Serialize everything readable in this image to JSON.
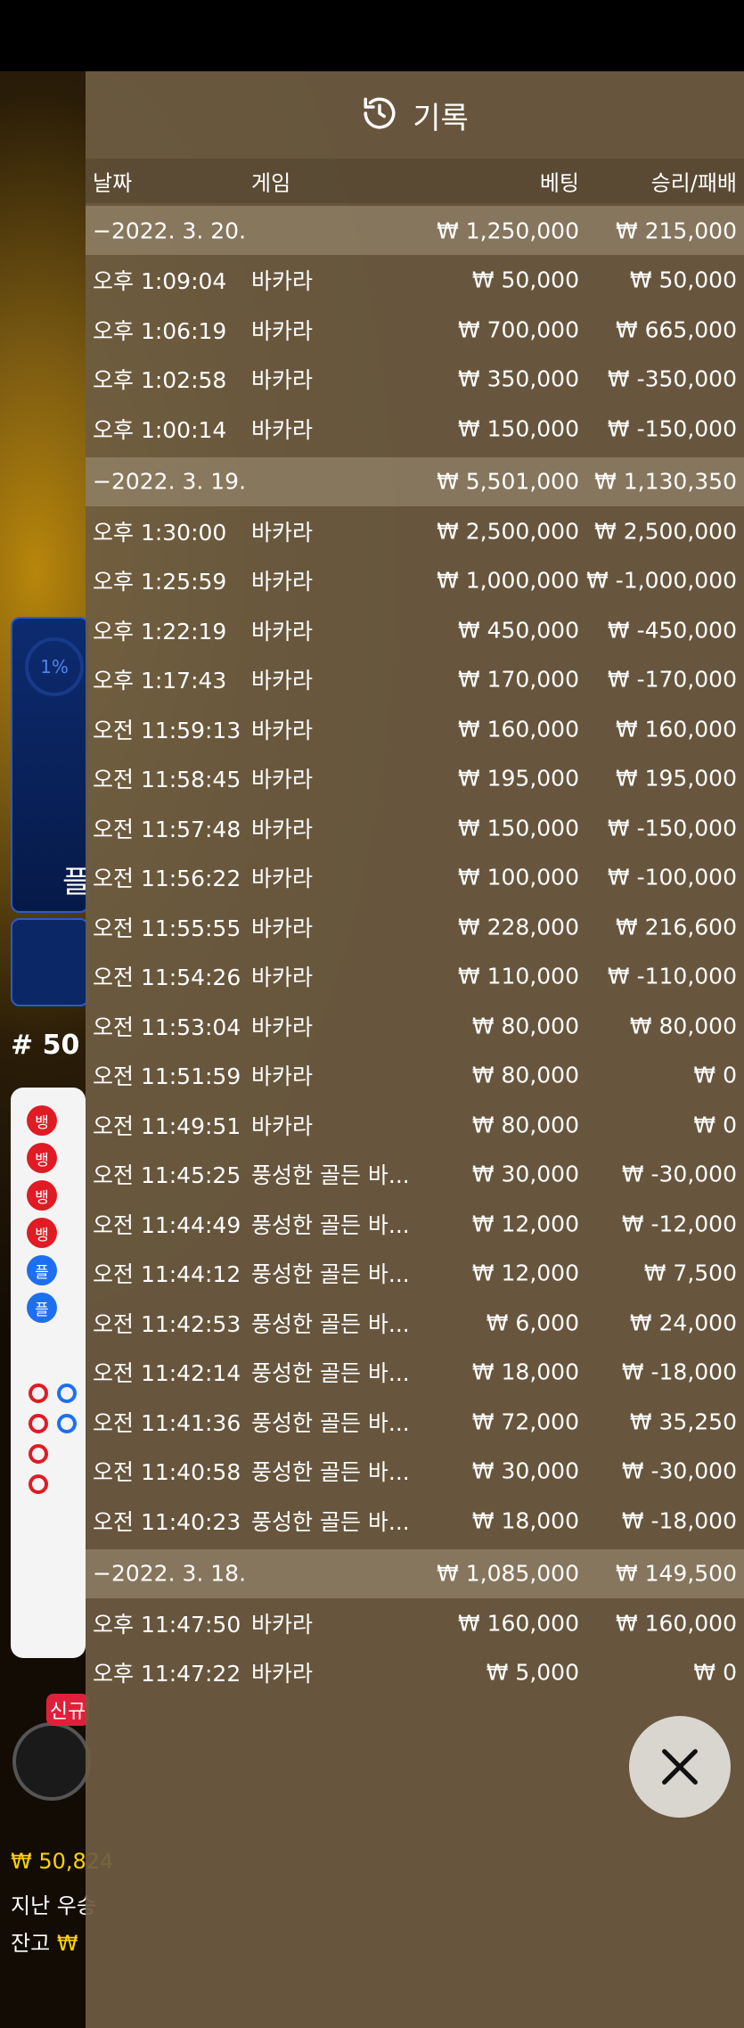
{
  "background": {
    "percent": "1%",
    "bet_char": "플",
    "game_number": "# 50",
    "new_badge": "신규",
    "balance_line": "₩ 50,824",
    "last_win_label": "지난 우승",
    "balance_label": "잔고",
    "balance_value": "₩"
  },
  "panel": {
    "title": "기록",
    "columns": {
      "date": "날짜",
      "game": "게임",
      "bet": "베팅",
      "result": "승리/패배"
    },
    "groups": [
      {
        "date": "−2022. 3. 20.",
        "bet": "₩ 1,250,000",
        "result": "₩ 215,000"
      },
      {
        "date": "−2022. 3. 19.",
        "bet": "₩ 5,501,000",
        "result": "₩ 1,130,350"
      },
      {
        "date": "−2022. 3. 18.",
        "bet": "₩ 1,085,000",
        "result": "₩ 149,500"
      }
    ],
    "rows": [
      {
        "time": "오후 1:09:04",
        "game": "바카라",
        "bet": "₩ 50,000",
        "result": "₩ 50,000"
      },
      {
        "time": "오후 1:06:19",
        "game": "바카라",
        "bet": "₩ 700,000",
        "result": "₩ 665,000"
      },
      {
        "time": "오후 1:02:58",
        "game": "바카라",
        "bet": "₩ 350,000",
        "result": "₩ -350,000"
      },
      {
        "time": "오후 1:00:14",
        "game": "바카라",
        "bet": "₩ 150,000",
        "result": "₩ -150,000"
      },
      {
        "time": "오후 1:30:00",
        "game": "바카라",
        "bet": "₩ 2,500,000",
        "result": "₩ 2,500,000"
      },
      {
        "time": "오후 1:25:59",
        "game": "바카라",
        "bet": "₩ 1,000,000",
        "result": "₩ -1,000,000"
      },
      {
        "time": "오후 1:22:19",
        "game": "바카라",
        "bet": "₩ 450,000",
        "result": "₩ -450,000"
      },
      {
        "time": "오후 1:17:43",
        "game": "바카라",
        "bet": "₩ 170,000",
        "result": "₩ -170,000"
      },
      {
        "time": "오전 11:59:13",
        "game": "바카라",
        "bet": "₩ 160,000",
        "result": "₩ 160,000"
      },
      {
        "time": "오전 11:58:45",
        "game": "바카라",
        "bet": "₩ 195,000",
        "result": "₩ 195,000"
      },
      {
        "time": "오전 11:57:48",
        "game": "바카라",
        "bet": "₩ 150,000",
        "result": "₩ -150,000"
      },
      {
        "time": "오전 11:56:22",
        "game": "바카라",
        "bet": "₩ 100,000",
        "result": "₩ -100,000"
      },
      {
        "time": "오전 11:55:55",
        "game": "바카라",
        "bet": "₩ 228,000",
        "result": "₩ 216,600"
      },
      {
        "time": "오전 11:54:26",
        "game": "바카라",
        "bet": "₩ 110,000",
        "result": "₩ -110,000"
      },
      {
        "time": "오전 11:53:04",
        "game": "바카라",
        "bet": "₩ 80,000",
        "result": "₩ 80,000"
      },
      {
        "time": "오전 11:51:59",
        "game": "바카라",
        "bet": "₩ 80,000",
        "result": "₩ 0"
      },
      {
        "time": "오전 11:49:51",
        "game": "바카라",
        "bet": "₩ 80,000",
        "result": "₩ 0"
      },
      {
        "time": "오전 11:45:25",
        "game": "풍성한 골든 바...",
        "bet": "₩ 30,000",
        "result": "₩ -30,000"
      },
      {
        "time": "오전 11:44:49",
        "game": "풍성한 골든 바...",
        "bet": "₩ 12,000",
        "result": "₩ -12,000"
      },
      {
        "time": "오전 11:44:12",
        "game": "풍성한 골든 바...",
        "bet": "₩ 12,000",
        "result": "₩ 7,500"
      },
      {
        "time": "오전 11:42:53",
        "game": "풍성한 골든 바...",
        "bet": "₩ 6,000",
        "result": "₩ 24,000"
      },
      {
        "time": "오전 11:42:14",
        "game": "풍성한 골든 바...",
        "bet": "₩ 18,000",
        "result": "₩ -18,000"
      },
      {
        "time": "오전 11:41:36",
        "game": "풍성한 골든 바...",
        "bet": "₩ 72,000",
        "result": "₩ 35,250"
      },
      {
        "time": "오전 11:40:58",
        "game": "풍성한 골든 바...",
        "bet": "₩ 30,000",
        "result": "₩ -30,000"
      },
      {
        "time": "오전 11:40:23",
        "game": "풍성한 골든 바...",
        "bet": "₩ 18,000",
        "result": "₩ -18,000"
      },
      {
        "time": "오후 11:47:50",
        "game": "바카라",
        "bet": "₩ 160,000",
        "result": "₩ 160,000"
      },
      {
        "time": "오후 11:47:22",
        "game": "바카라",
        "bet": "₩ 5,000",
        "result": "₩ 0"
      }
    ],
    "close_icon": "close-icon",
    "history_icon": "history-icon"
  },
  "colors": {
    "panel_bg": "#6e5c42",
    "banker_red": "#e01b24",
    "player_blue": "#1e6ff0",
    "win_yellow": "#ffd200"
  }
}
